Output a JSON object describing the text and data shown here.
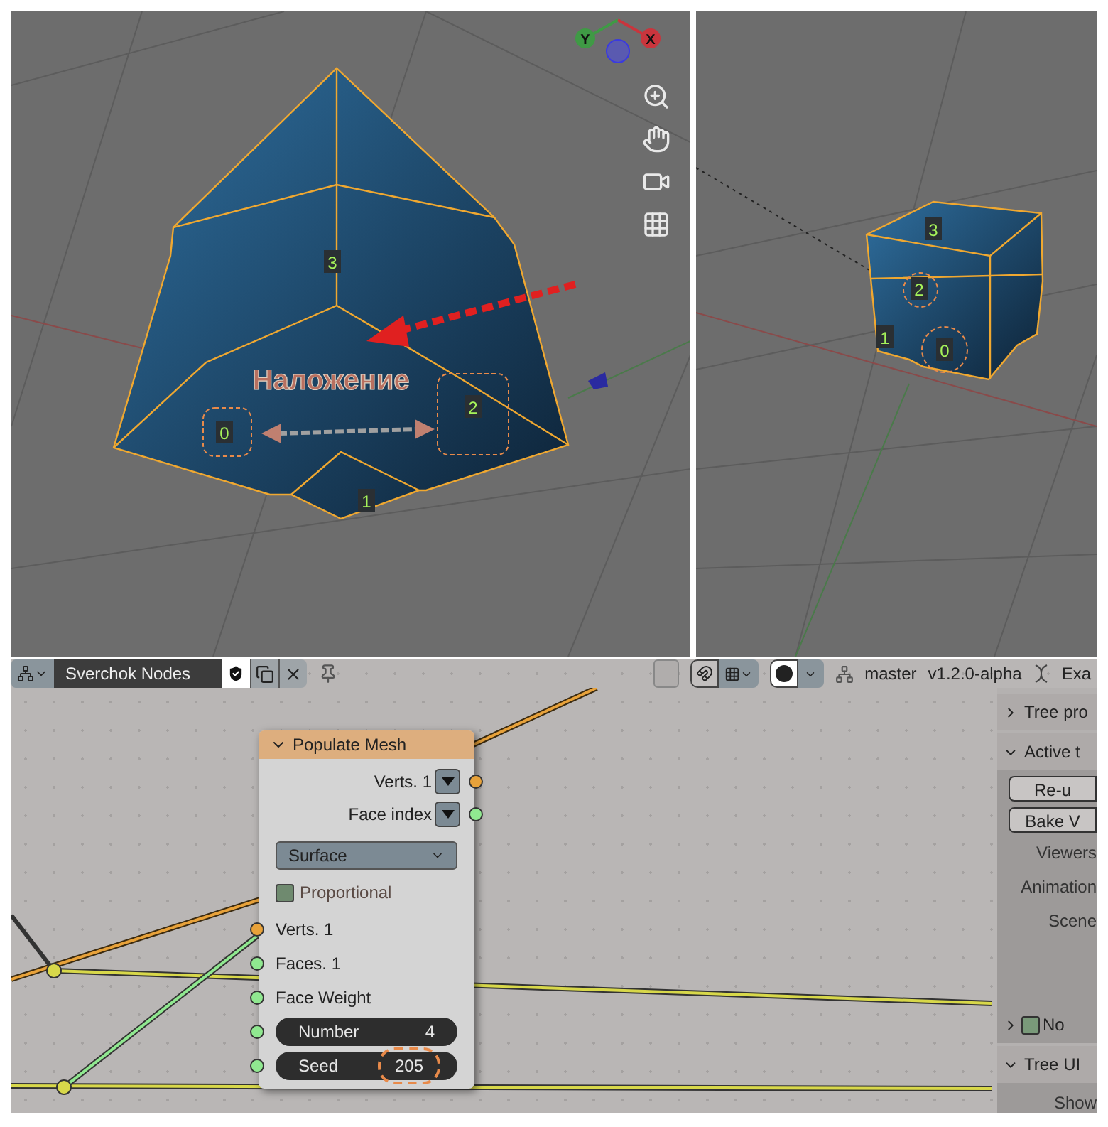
{
  "viewport_left": {
    "gizmo_axes": [
      {
        "label": "Y",
        "color": "#3f9a45"
      },
      {
        "label": "X",
        "color": "#c9353d"
      }
    ],
    "face_labels": [
      "3",
      "0",
      "2",
      "1"
    ],
    "annotation": "Наложение"
  },
  "viewport_right": {
    "face_labels": [
      "3",
      "2",
      "1",
      "0"
    ]
  },
  "header": {
    "tree_name": "Sverchok Nodes",
    "branch": "master",
    "version": "v1.2.0-alpha",
    "workspace": "Exa"
  },
  "node": {
    "title": "Populate Mesh",
    "expanded": true,
    "outputs": [
      {
        "label": "Verts. 1",
        "color": "#e8a23a"
      },
      {
        "label": "Face index",
        "color": "#90e890"
      }
    ],
    "mode": "Surface",
    "proportional": {
      "label": "Proportional",
      "checked": false
    },
    "inputs": [
      {
        "kind": "socket",
        "label": "Verts. 1",
        "color": "#e8a23a"
      },
      {
        "kind": "socket",
        "label": "Faces. 1",
        "color": "#90e890"
      },
      {
        "kind": "socket",
        "label": "Face Weight",
        "color": "#90e890"
      },
      {
        "kind": "field",
        "label": "Number",
        "value": "4",
        "color": "#90e890",
        "highlighted": false
      },
      {
        "kind": "field",
        "label": "Seed",
        "value": "205",
        "color": "#90e890",
        "highlighted": true
      }
    ]
  },
  "sidebar": {
    "panels": [
      {
        "title": "Tree pro",
        "expanded": false
      },
      {
        "title": "Active t",
        "expanded": true,
        "buttons": [
          "Re-u",
          "Bake V"
        ],
        "rows": [
          "Viewers",
          "Animation",
          "Scene"
        ],
        "subpanel": {
          "title": "No",
          "expanded": false,
          "checked": false
        }
      },
      {
        "title": "Tree UI",
        "expanded": true,
        "rows": [
          "Show"
        ]
      }
    ]
  }
}
